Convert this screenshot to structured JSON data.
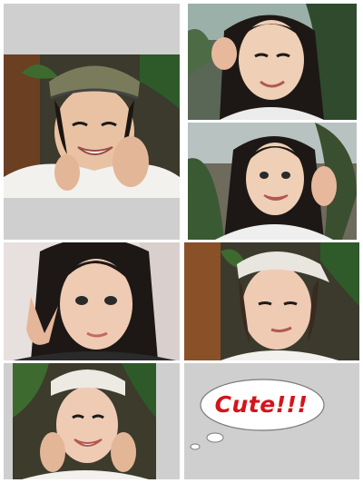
{
  "collage": {
    "photos": [
      {
        "name": "photo-girl-cap-smiling",
        "description_icon": "portrait-photo"
      },
      {
        "name": "photo-girl-hand-on-cheek",
        "description_icon": "portrait-photo"
      },
      {
        "name": "photo-girl-waving",
        "description_icon": "portrait-photo"
      },
      {
        "name": "photo-girl-peace-sign",
        "description_icon": "portrait-photo"
      },
      {
        "name": "photo-girl-cap-smirk",
        "description_icon": "portrait-photo"
      },
      {
        "name": "photo-girl-cap-hands-on-cheeks",
        "description_icon": "portrait-photo"
      }
    ]
  },
  "speech_bubble": {
    "text": "Cute!!!",
    "text_color": "#d4141b"
  },
  "colors": {
    "panel_grey": "#cfcfcf",
    "background": "#ffffff"
  }
}
